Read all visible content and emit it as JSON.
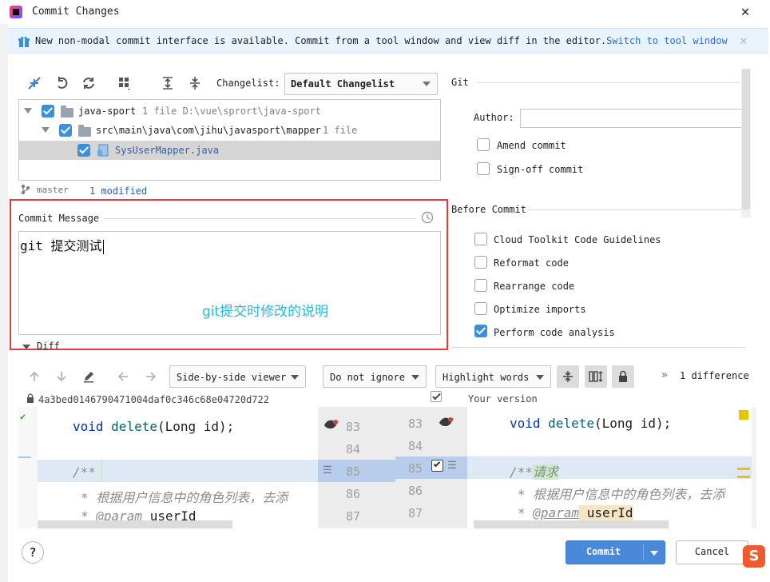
{
  "window": {
    "title": "Commit Changes"
  },
  "banner": {
    "text": "New non-modal commit interface is available. Commit from a tool window and view diff in the editor.",
    "link": "Switch to tool window"
  },
  "toolbar": {
    "changelist_label": "Changelist:",
    "changelist_value": "Default Changelist"
  },
  "tree": {
    "rows": [
      {
        "name": "java-sport",
        "detail": "1 file  D:\\vue\\sprort\\java-sport"
      },
      {
        "name": "src\\main\\java\\com\\jihu\\javasport\\mapper",
        "detail": "1 file"
      },
      {
        "name": "SysUserMapper.java",
        "detail": ""
      }
    ]
  },
  "status": {
    "branch": "master",
    "modified": "1 modified"
  },
  "commit_message": {
    "label": "Commit Message",
    "value": "git 提交测试",
    "annotation": "git提交时修改的说明"
  },
  "diff_section": {
    "label": "Diff"
  },
  "git": {
    "label": "Git",
    "author_label": "Author:",
    "author_value": "",
    "amend": "Amend commit",
    "signoff": "Sign-off commit"
  },
  "before_commit": {
    "label": "Before Commit",
    "options": [
      {
        "label": "Cloud Toolkit Code Guidelines",
        "checked": false
      },
      {
        "label": "Reformat code",
        "checked": false
      },
      {
        "label": "Rearrange code",
        "checked": false
      },
      {
        "label": "Optimize imports",
        "checked": false
      },
      {
        "label": "Perform code analysis",
        "checked": true
      }
    ]
  },
  "diff_toolbar": {
    "viewer": "Side-by-side viewer",
    "ignore": "Do not ignore",
    "highlight": "Highlight words",
    "difference_count": "1 difference"
  },
  "diff": {
    "left_hash": "4a3bed0146790471004daf0c346c68e04720d722",
    "right_label": "Your version",
    "left_lines": [
      "83",
      "84",
      "85",
      "86",
      "87"
    ],
    "right_lines": [
      "83",
      "84",
      "85",
      "86",
      "87"
    ],
    "left_code": {
      "l1_kw": "void",
      "l1_fn": "delete",
      "l1_rest": "(Long id);",
      "l3": "/**",
      "l4": "* 根据用户信息中的角色列表，去添",
      "l5_star": "* ",
      "l5_tag": "@param",
      "l5_rest": " userId"
    },
    "right_code": {
      "l1_kw": "void",
      "l1_fn": "delete",
      "l1_rest": "(Long id);",
      "l3_a": "/**",
      "l3_b": "请求",
      "l4": "* 根据用户信息中的角色列表，去添",
      "l5_star": "* ",
      "l5_tag": "@param",
      "l5_rest": " userId"
    }
  },
  "buttons": {
    "help": "?",
    "commit": "Commit",
    "cancel": "Cancel"
  },
  "colors": {
    "accent": "#4a89d9",
    "annotation": "#27b8d8",
    "highlight_box": "#e43b3b",
    "diff_changed": "#dfe9f6",
    "diff_inserted": "#c9ebc9"
  }
}
